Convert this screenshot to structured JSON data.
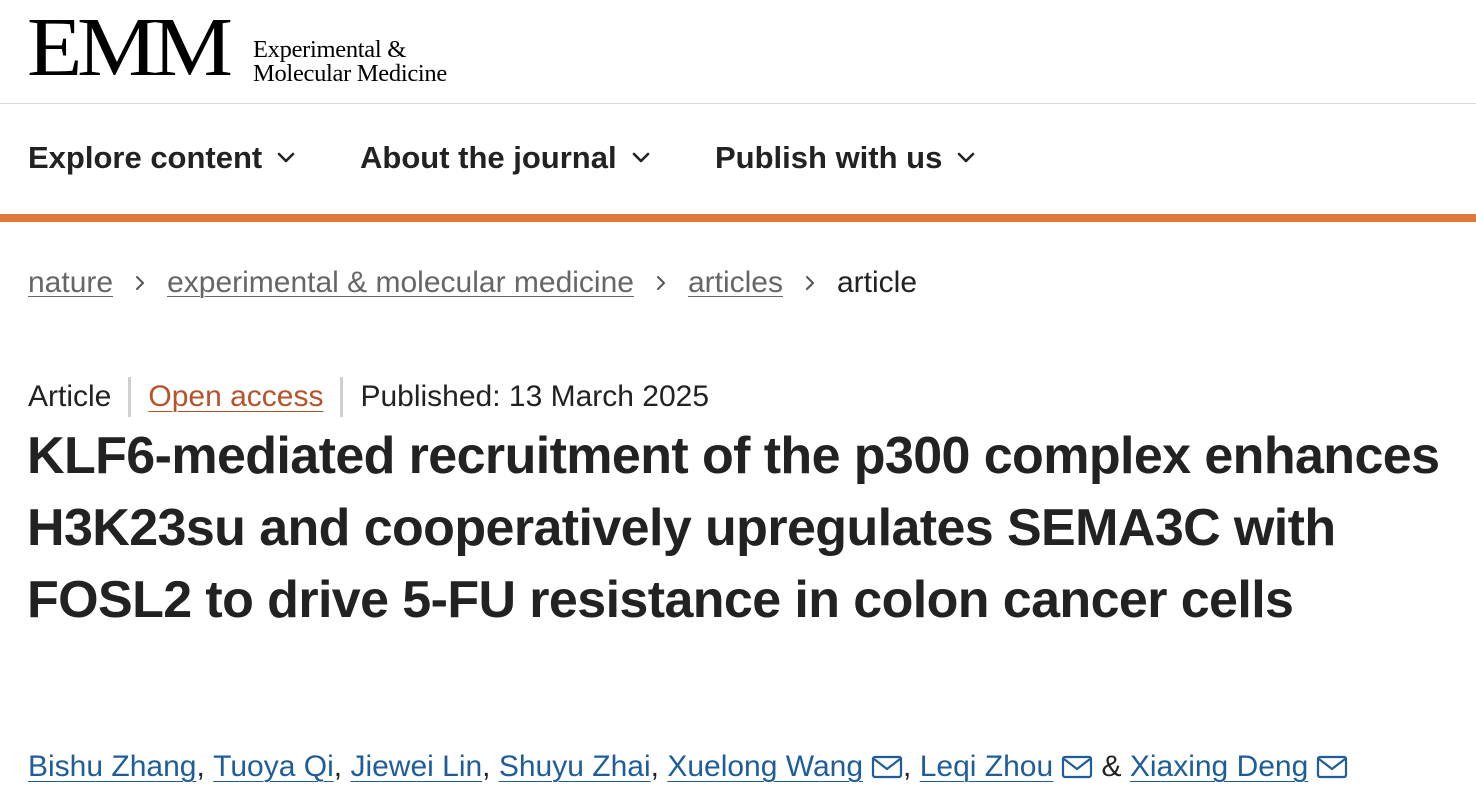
{
  "header": {
    "logo_mark": "EMM",
    "logo_line1": "Experimental &",
    "logo_line2": "Molecular Medicine"
  },
  "nav": {
    "items": [
      {
        "label": "Explore content"
      },
      {
        "label": "About the journal"
      },
      {
        "label": "Publish with us"
      }
    ],
    "accent_color": "#e0783a"
  },
  "breadcrumb": {
    "items": [
      {
        "label": "nature"
      },
      {
        "label": "experimental & molecular medicine"
      },
      {
        "label": "articles"
      }
    ],
    "current": "article"
  },
  "article": {
    "type": "Article",
    "access": "Open access",
    "published": "Published: 13 March 2025",
    "title": "KLF6-mediated recruitment of the p300 complex enhances H3K23su and cooperatively upregulates SEMA3C with FOSL2 to drive 5-FU resistance in colon cancer cells",
    "authors": [
      {
        "name": "Bishu Zhang",
        "email_icon": false
      },
      {
        "name": "Tuoya Qi",
        "email_icon": false
      },
      {
        "name": "Jiewei Lin",
        "email_icon": false
      },
      {
        "name": "Shuyu Zhai",
        "email_icon": false
      },
      {
        "name": "Xuelong Wang",
        "email_icon": true
      },
      {
        "name": "Leqi Zhou",
        "email_icon": true
      },
      {
        "name": "Xiaxing Deng",
        "email_icon": true
      }
    ],
    "author_separator": ",",
    "author_last_separator": "&",
    "access_color": "#b5532a",
    "author_link_color": "#1f5d9a"
  }
}
